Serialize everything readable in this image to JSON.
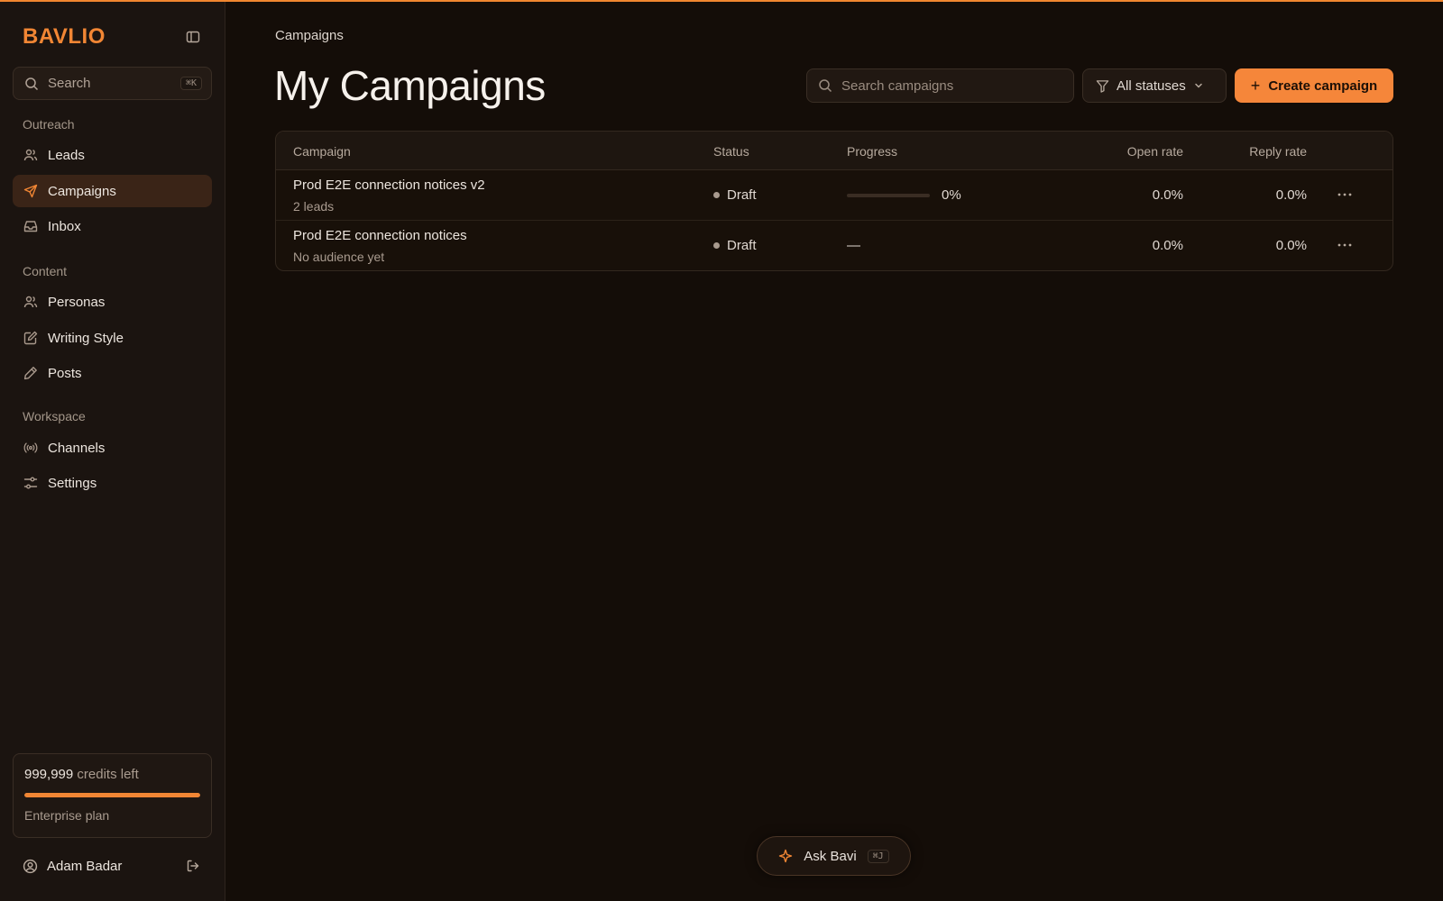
{
  "brand": {
    "logo": "BAVLIO",
    "accent": "#f18634"
  },
  "sidebar": {
    "search": {
      "label": "Search",
      "shortcut": "⌘K"
    },
    "sections": [
      {
        "label": "Outreach",
        "items": [
          {
            "label": "Leads",
            "icon": "users-icon"
          },
          {
            "label": "Campaigns",
            "icon": "send-icon",
            "active": true
          },
          {
            "label": "Inbox",
            "icon": "inbox-icon"
          }
        ]
      },
      {
        "label": "Content",
        "items": [
          {
            "label": "Personas",
            "icon": "users-icon"
          },
          {
            "label": "Writing Style",
            "icon": "edit-icon"
          },
          {
            "label": "Posts",
            "icon": "pencil-icon"
          }
        ]
      },
      {
        "label": "Workspace",
        "items": [
          {
            "label": "Channels",
            "icon": "broadcast-icon"
          },
          {
            "label": "Settings",
            "icon": "sliders-icon"
          }
        ]
      }
    ],
    "credits": {
      "amount": "999,999",
      "suffix": "credits left",
      "plan": "Enterprise plan",
      "fill_fraction": 1.0
    },
    "user": {
      "name": "Adam Badar"
    }
  },
  "main": {
    "breadcrumb": "Campaigns",
    "title": "My Campaigns",
    "search": {
      "placeholder": "Search campaigns",
      "value": ""
    },
    "status_filter": {
      "selected": "All statuses"
    },
    "create_button": "Create campaign",
    "table": {
      "columns": [
        "Campaign",
        "Status",
        "Progress",
        "Open rate",
        "Reply rate"
      ],
      "rows": [
        {
          "name": "Prod E2E connection notices v2",
          "sub": "2 leads",
          "status": "Draft",
          "progress": "0%",
          "progress_fraction": 0,
          "open_rate": "0.0%",
          "reply_rate": "0.0%"
        },
        {
          "name": "Prod E2E connection notices",
          "sub": "No audience yet",
          "status": "Draft",
          "progress": "—",
          "open_rate": "0.0%",
          "reply_rate": "0.0%"
        }
      ]
    }
  },
  "assistant": {
    "label": "Ask Bavi",
    "shortcut": "⌘J"
  }
}
